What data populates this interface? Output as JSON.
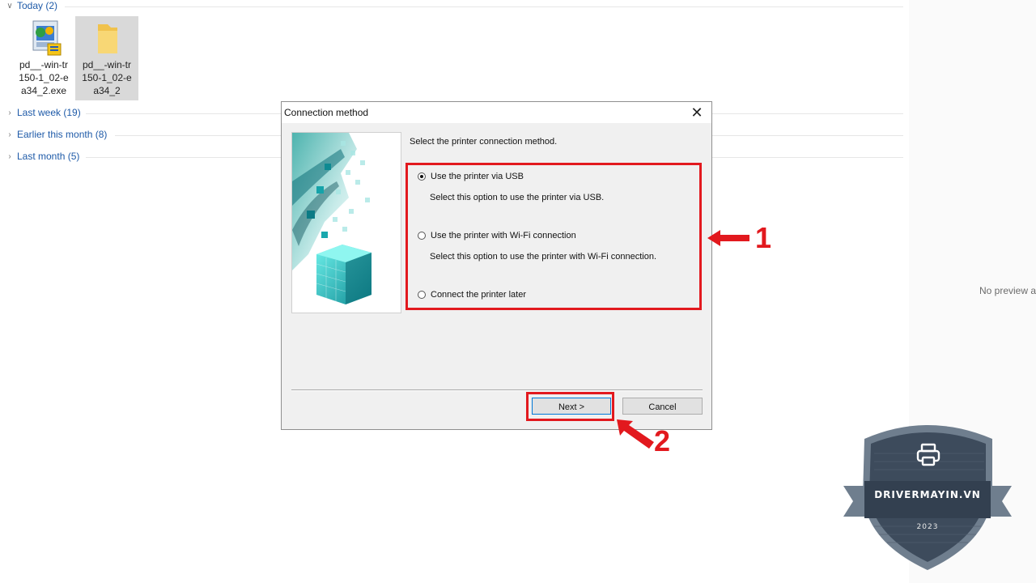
{
  "explorer": {
    "groups": [
      {
        "label": "Today (2)",
        "expanded": true
      },
      {
        "label": "Last week (19)",
        "expanded": false
      },
      {
        "label": "Earlier this month (8)",
        "expanded": false
      },
      {
        "label": "Last month (5)",
        "expanded": false
      }
    ],
    "files": [
      {
        "lines": [
          "pd__-win-tr",
          "150-1_02-e",
          "a34_2.exe"
        ],
        "icon": "installer-exe-icon",
        "selected": false
      },
      {
        "lines": [
          "pd__-win-tr",
          "150-1_02-e",
          "a34_2"
        ],
        "icon": "folder-icon",
        "selected": true
      }
    ],
    "preview_text": "No preview a"
  },
  "dialog": {
    "title": "Connection method",
    "prompt": "Select the printer connection method.",
    "options": [
      {
        "label": "Use the printer via USB",
        "description": "Select this option to use the printer via USB.",
        "selected": true
      },
      {
        "label": "Use the printer with Wi-Fi connection",
        "description": "Select this option to use the printer with Wi-Fi connection.",
        "selected": false
      },
      {
        "label": "Connect the printer later",
        "description": "",
        "selected": false
      }
    ],
    "buttons": {
      "next": "Next >",
      "cancel": "Cancel"
    }
  },
  "annotations": {
    "step1": "1",
    "step2": "2",
    "color": "#e2191e"
  },
  "watermark": {
    "brand": "DRIVERMAYIN.VN",
    "year": "2023",
    "icon": "printer-icon"
  }
}
